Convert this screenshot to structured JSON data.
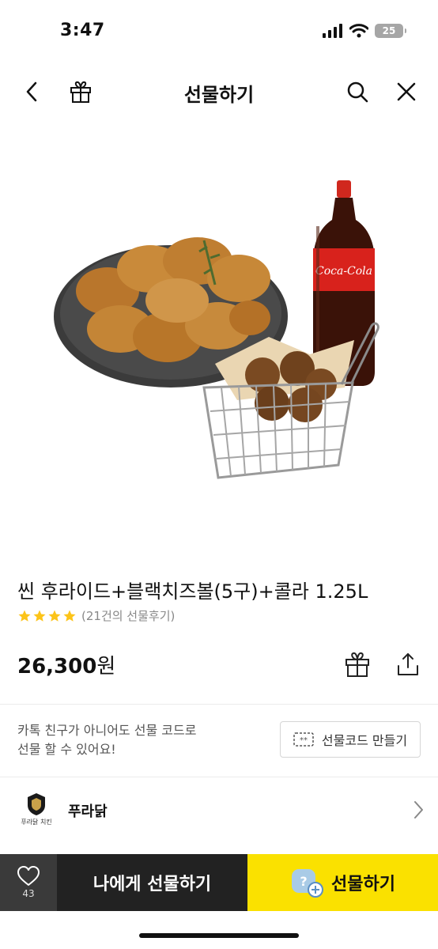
{
  "status_bar": {
    "time": "3:47",
    "battery": "25"
  },
  "nav": {
    "title": "선물하기"
  },
  "product": {
    "name": "씬 후라이드+블랙치즈볼(5구)+콜라 1.25L",
    "rating": 4,
    "review_count": "(21건의 선물후기)",
    "price": "26,300",
    "price_unit": "원",
    "can_label": "Coca-Cola"
  },
  "gift_code": {
    "line1": "카톡 친구가 아니어도 선물 코드로",
    "line2": "선물 할 수 있어요!",
    "button_label": "선물코드 만들기"
  },
  "brand": {
    "name": "푸라닭",
    "logo_text": "푸라닭 치킨"
  },
  "bottom_bar": {
    "like_count": "43",
    "self_gift_label": "나에게 선물하기",
    "gift_label": "선물하기"
  },
  "colors": {
    "accent": "#fae100",
    "dark": "#222222",
    "star": "#fcc419"
  }
}
